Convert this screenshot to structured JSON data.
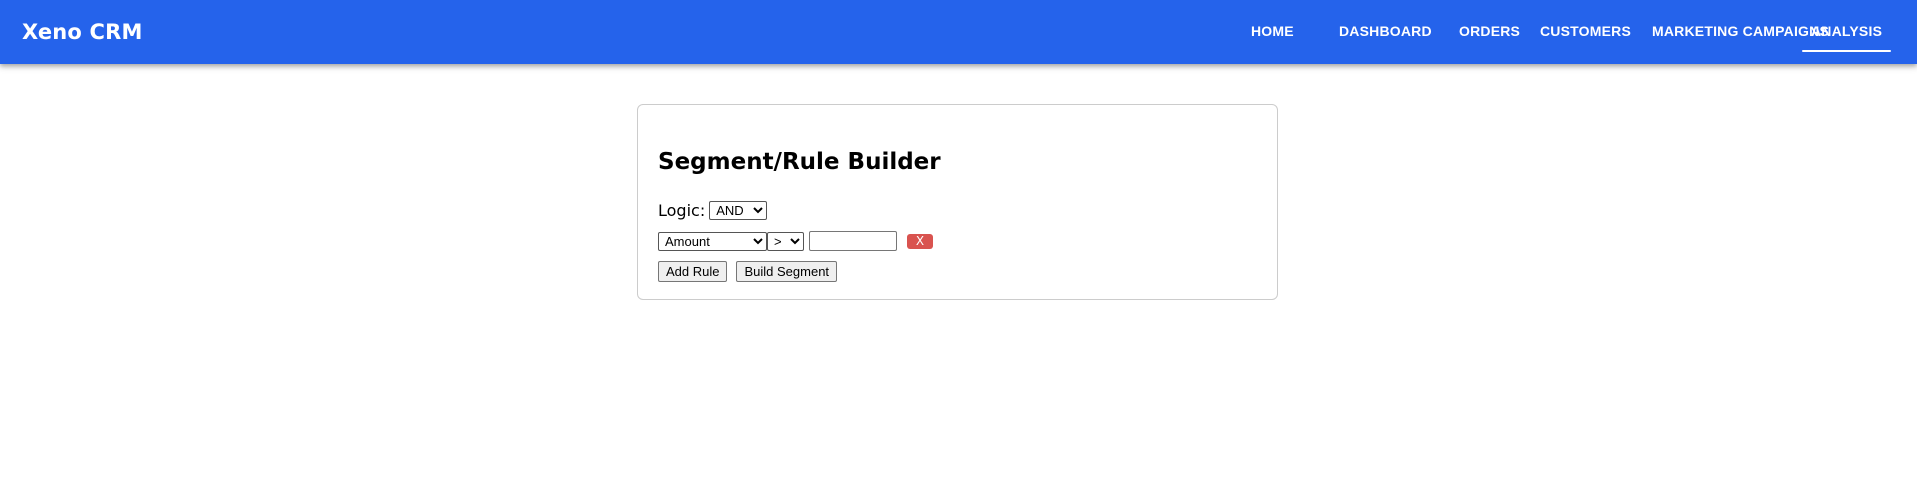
{
  "app": {
    "brand": "Xeno CRM",
    "accent_color": "#2563eb"
  },
  "nav": {
    "items": [
      {
        "label": "HOME",
        "active": false
      },
      {
        "label": "DASHBOARD",
        "active": false
      },
      {
        "label": "ORDERS",
        "active": false
      },
      {
        "label": "CUSTOMERS",
        "active": false
      },
      {
        "label": "MARKETING CAMPAIGNS",
        "active": false
      },
      {
        "label": "ANALYSIS",
        "active": true
      }
    ]
  },
  "builder": {
    "title": "Segment/Rule Builder",
    "logic_label": "Logic:",
    "logic_value": "AND",
    "rules": [
      {
        "field": "Amount",
        "operator": ">",
        "value": ""
      }
    ],
    "remove_label": "X",
    "add_rule_label": "Add Rule",
    "build_segment_label": "Build Segment",
    "remove_color": "#d9534f"
  }
}
